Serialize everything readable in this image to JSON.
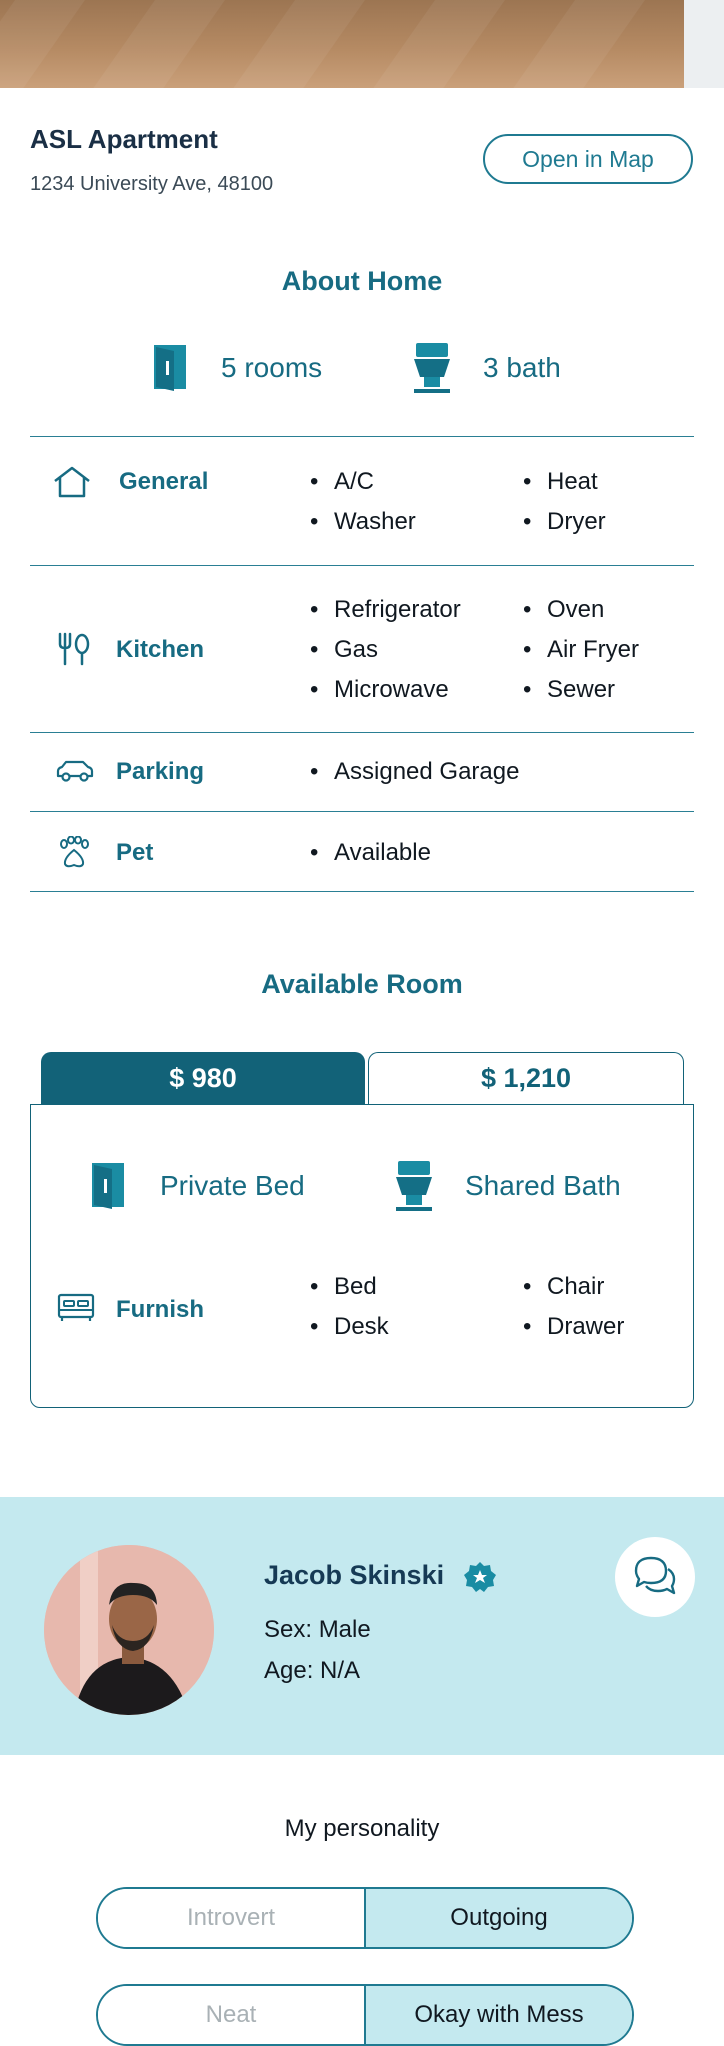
{
  "listing": {
    "title": "ASL Apartment",
    "address": "1234 University Ave, 48100",
    "map_button": "Open in Map"
  },
  "about": {
    "title": "About Home",
    "rooms": "5 rooms",
    "baths": "3 bath",
    "rooms_icon": "door-icon",
    "baths_icon": "toilet-icon"
  },
  "features": {
    "general": {
      "label": "General",
      "icon": "house-icon",
      "col1": [
        "A/C",
        "Washer"
      ],
      "col2": [
        "Heat",
        "Dryer"
      ]
    },
    "kitchen": {
      "label": "Kitchen",
      "icon": "utensils-icon",
      "col1": [
        "Refrigerator",
        "Gas",
        "Microwave"
      ],
      "col2": [
        "Oven",
        "Air Fryer",
        "Sewer"
      ]
    },
    "parking": {
      "label": "Parking",
      "icon": "car-icon",
      "items": [
        "Assigned Garage"
      ]
    },
    "pet": {
      "label": "Pet",
      "icon": "paw-icon",
      "items": [
        "Available"
      ]
    }
  },
  "available_room": {
    "title": "Available Room",
    "tabs": [
      "$ 980",
      "$ 1,210"
    ],
    "selected_tab": 0,
    "bed": "Private Bed",
    "bath": "Shared Bath",
    "furnish": {
      "label": "Furnish",
      "icon": "bed-icon",
      "col1": [
        "Bed",
        "Desk"
      ],
      "col2": [
        "Chair",
        "Drawer"
      ]
    }
  },
  "owner": {
    "name": "Jacob Skinski",
    "sex": "Sex: Male",
    "age": "Age: N/A",
    "verified_icon": "verified-badge-icon",
    "chat_icon": "chat-bubbles-icon"
  },
  "personality": {
    "title": "My personality",
    "pairs": [
      {
        "left": "Introvert",
        "right": "Outgoing",
        "selected": "right"
      },
      {
        "left": "Neat",
        "right": "Okay with Mess",
        "selected": "right"
      }
    ]
  },
  "colors": {
    "accent": "#176b82",
    "accent_dark": "#126278",
    "profile_bg": "#c4e9ef"
  }
}
